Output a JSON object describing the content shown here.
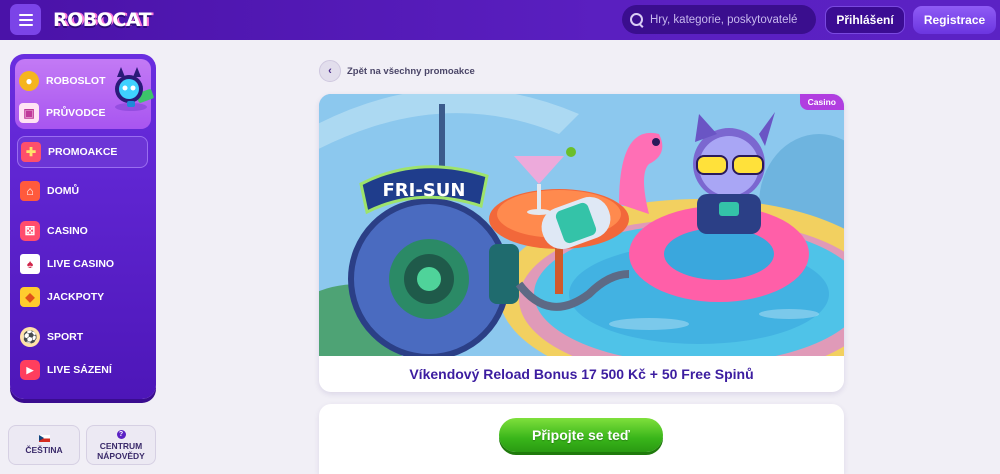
{
  "header": {
    "logo_text": "ROBOCAT",
    "search_placeholder": "Hry, kategorie, poskytovatelé",
    "login_label": "Přihlášení",
    "register_label": "Registrace"
  },
  "sidebar": {
    "promo_items": [
      {
        "label": "ROBOSLOT",
        "icon": "coin-icon"
      },
      {
        "label": "PRŮVODCE",
        "icon": "gift-box-icon"
      }
    ],
    "items": [
      {
        "label": "PROMOAKCE",
        "icon": "gift-icon",
        "active": true
      },
      {
        "label": "DOMŮ",
        "icon": "home-icon"
      },
      {
        "label": "CASINO",
        "icon": "dice-icon"
      },
      {
        "label": "LIVE CASINO",
        "icon": "cards-icon"
      },
      {
        "label": "JACKPOTY",
        "icon": "diamond-icon"
      },
      {
        "label": "SPORT",
        "icon": "ball-icon"
      },
      {
        "label": "LIVE SÁZENÍ",
        "icon": "live-icon"
      }
    ],
    "language_label": "ČEŠTINA",
    "help_label_line1": "CENTRUM",
    "help_label_line2": "NÁPOVĚDY"
  },
  "main": {
    "back_label": "Zpět na všechny promoakce",
    "tag": "Casino",
    "sign_text": "FRI-SUN",
    "promo_title": "Víkendový Reload Bonus 17 500 Kč + 50 Free Spinů",
    "cta_label": "Připojte se teď"
  },
  "colors": {
    "header_bg": "#4a12a8",
    "sidebar_bg": "#5a1fc8",
    "accent_purple": "#3c1da0",
    "cta_green": "#39b51a",
    "tag_bg": "#b13ee0"
  }
}
